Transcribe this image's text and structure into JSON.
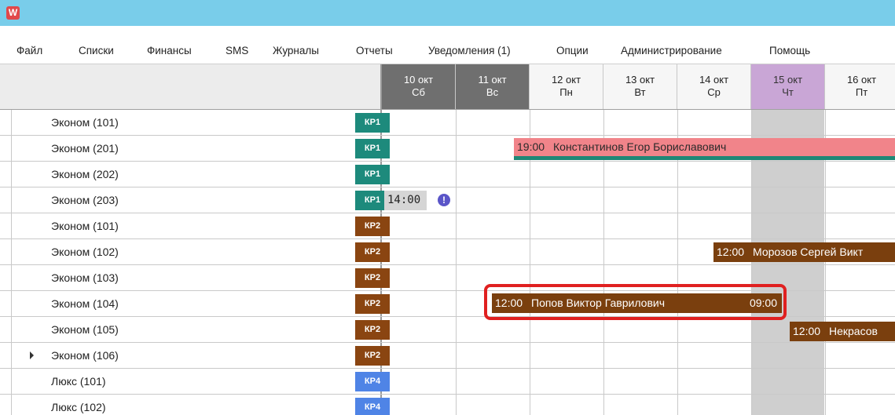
{
  "app": {
    "icon": "app-logo-icon",
    "icon_glyph": "W"
  },
  "menu": [
    {
      "label": "Файл"
    },
    {
      "label": "Списки"
    },
    {
      "label": "Финансы"
    },
    {
      "label": "SMS"
    },
    {
      "label": "Журналы"
    },
    {
      "label": "Отчеты"
    },
    {
      "label": "Уведомления (1)"
    },
    {
      "label": "Опции"
    },
    {
      "label": "Администрирование"
    },
    {
      "label": "Помощь"
    }
  ],
  "days": [
    {
      "date": "10 окт",
      "weekday": "Сб",
      "kind": "weekend"
    },
    {
      "date": "11 окт",
      "weekday": "Вс",
      "kind": "weekend"
    },
    {
      "date": "12 окт",
      "weekday": "Пн",
      "kind": "normal"
    },
    {
      "date": "13 окт",
      "weekday": "Вт",
      "kind": "normal"
    },
    {
      "date": "14 окт",
      "weekday": "Ср",
      "kind": "normal"
    },
    {
      "date": "15 окт",
      "weekday": "Чт",
      "kind": "today"
    },
    {
      "date": "16 окт",
      "weekday": "Пт",
      "kind": "normal"
    }
  ],
  "rooms": [
    {
      "name": "Эконом (101)",
      "badge": "КР1"
    },
    {
      "name": "Эконом (201)",
      "badge": "КР1"
    },
    {
      "name": "Эконом (202)",
      "badge": "КР1"
    },
    {
      "name": "Эконом (203)",
      "badge": "КР1"
    },
    {
      "name": "Эконом (101)",
      "badge": "КР2"
    },
    {
      "name": "Эконом (102)",
      "badge": "КР2"
    },
    {
      "name": "Эконом (103)",
      "badge": "КР2"
    },
    {
      "name": "Эконом (104)",
      "badge": "КР2"
    },
    {
      "name": "Эконом (105)",
      "badge": "КР2"
    },
    {
      "name": "Эконом (106)",
      "badge": "КР2"
    },
    {
      "name": "Люкс (101)",
      "badge": "КР4"
    },
    {
      "name": "Люкс (102)",
      "badge": "КР4"
    }
  ],
  "bookings": [
    {
      "time": "19:00",
      "guest": "Константинов Егор Бориславович",
      "end": ""
    },
    {
      "time": "14:00",
      "guest": "",
      "end": ""
    },
    {
      "time": "12:00",
      "guest": "Морозов Сергей Викт",
      "end": ""
    },
    {
      "time": "12:00",
      "guest": "Попов Виктор Гаврилович",
      "end": "09:00"
    },
    {
      "time": "12:00",
      "guest": "Некрасов",
      "end": ""
    }
  ],
  "alert": {
    "icon": "exclamation-icon",
    "glyph": "!"
  },
  "colors": {
    "titlebar": "#79cdea",
    "weekend_header": "#6f6f6f",
    "today_header": "#c9a6d6",
    "kr1": "#1d8a7c",
    "kr2": "#8a4511",
    "kr4": "#4f84e6",
    "booking_brown": "#7a3f0e",
    "booking_pink": "#f1848a",
    "highlight": "#e02020"
  }
}
